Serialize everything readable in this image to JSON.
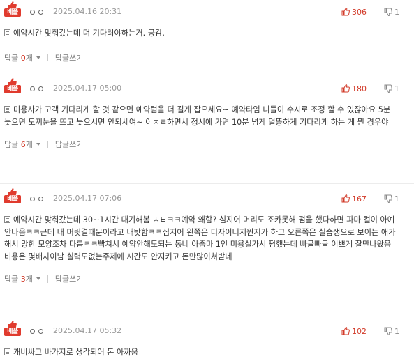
{
  "badge_label": "베플",
  "reply_label_prefix": "답글",
  "reply_count_suffix": "개",
  "write_reply_label": "답글쓰기",
  "comments": [
    {
      "date": "2025.04.16 20:31",
      "up": "306",
      "down": "1",
      "text": "예약시간 맞춰갔는데 더 기다려야하는거. 공감.",
      "replies": null
    },
    {
      "date": "2025.04.17 05:00",
      "up": "180",
      "down": "1",
      "text": "미용사가 고객 기다리게 할 것 같으면 예약텀을 더 길게 잡으세요~ 예약타임 니들이 수시로 조정 할 수 있잖아요 5분 늦으면 도끼눈을 뜨고 늦으시면 안되세여~ 이ㅈㄹ하면서 정시에 가면 10분 넘게 멀뚱하게 기다리게 하는 게 뭔 경우야",
      "replies": "6"
    },
    {
      "date": "2025.04.17 07:06",
      "up": "167",
      "down": "1",
      "text": "예약시간 맞춰갔는데 30~1시간 대기해봄 ㅅㅂㅋㅋ예약 왜함? 심지어 머리도 조카못해 펌을 했다하면 파마 컬이 아예 안나옴ㅋㅋ근데 내 머릿결때문이라고 내탓함ㅋㅋ심지어 왼쪽은 디자이너지원지가 하고 오른쪽은 실습생으로 보이는 애가 해서 망한 모양조차 다름ㅋㅋ빡쳐서 예약안해도되는 동네 아줌마 1인 미용실가서 펌했는데 빠글빠글 이쁘게 잘만나왔음 비용은 몇배차이남 실력도없는주제에 시간도 안지키고 돈만많이쳐받네",
      "replies": "3"
    },
    {
      "date": "2025.04.17 05:32",
      "up": "102",
      "down": "1",
      "text": "개비싸고 바가지로 생각되어 돈 아까움",
      "replies": null
    }
  ],
  "colors": {
    "accent": "#d23b2a",
    "badge": "#e03b2e"
  }
}
